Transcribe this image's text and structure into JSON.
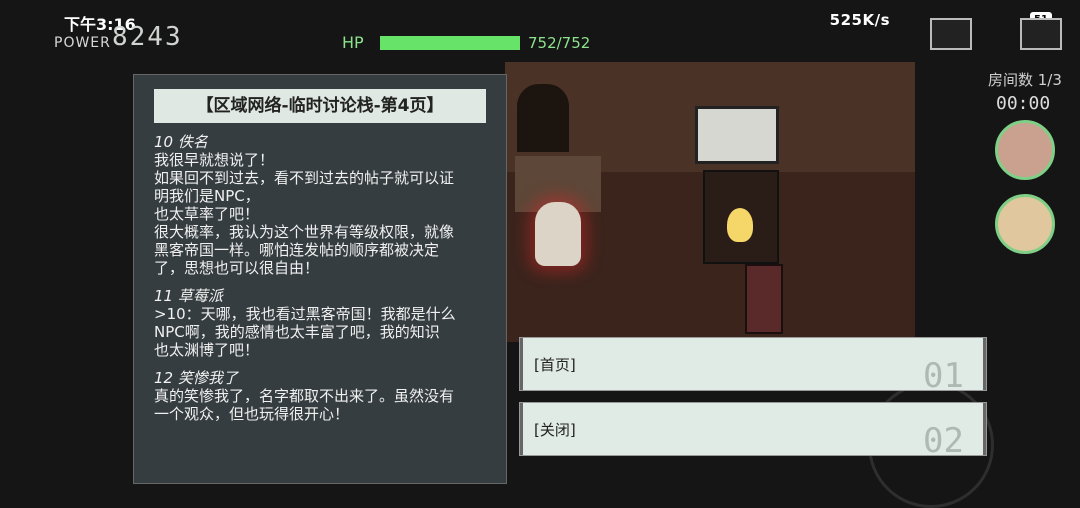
{
  "status_bar": {
    "time": "下午3:16",
    "right": "525K/s",
    "battery": "51"
  },
  "hud": {
    "power_label": "POWER",
    "power_value": "8243",
    "hp_label": "HP",
    "hp_value": "752/752",
    "hp_fraction": 1.0,
    "room_count": "房间数 1/3",
    "timer": "00:00"
  },
  "dialog": {
    "title": "【区域网络-临时讨论栈-第4页】",
    "posts": [
      {
        "author": "10 佚名",
        "lines": [
          "我很早就想说了！",
          "如果回不到过去，看不到过去的帖子就可以证",
          "明我们是NPC，",
          "也太草率了吧！",
          "很大概率，我认为这个世界有等级权限，就像",
          "黑客帝国一样。哪怕连发帖的顺序都被决定",
          "了，思想也可以很自由！"
        ]
      },
      {
        "author": "11 草莓派",
        "lines": [
          ">10：天哪，我也看过黑客帝国！我都是什么",
          "NPC啊，我的感情也太丰富了吧，我的知识",
          "也太渊博了吧！"
        ]
      },
      {
        "author": "12 笑惨我了",
        "lines": [
          "真的笑惨我了，名字都取不出来了。虽然没有",
          "一个观众，但也玩得很开心！"
        ]
      }
    ]
  },
  "menu": [
    {
      "label": "[首页]",
      "num": "01"
    },
    {
      "label": "[关闭]",
      "num": "02"
    }
  ],
  "colors": {
    "hp": "#67e36a",
    "panel": "#373f42",
    "button": "#e1ebe5"
  }
}
